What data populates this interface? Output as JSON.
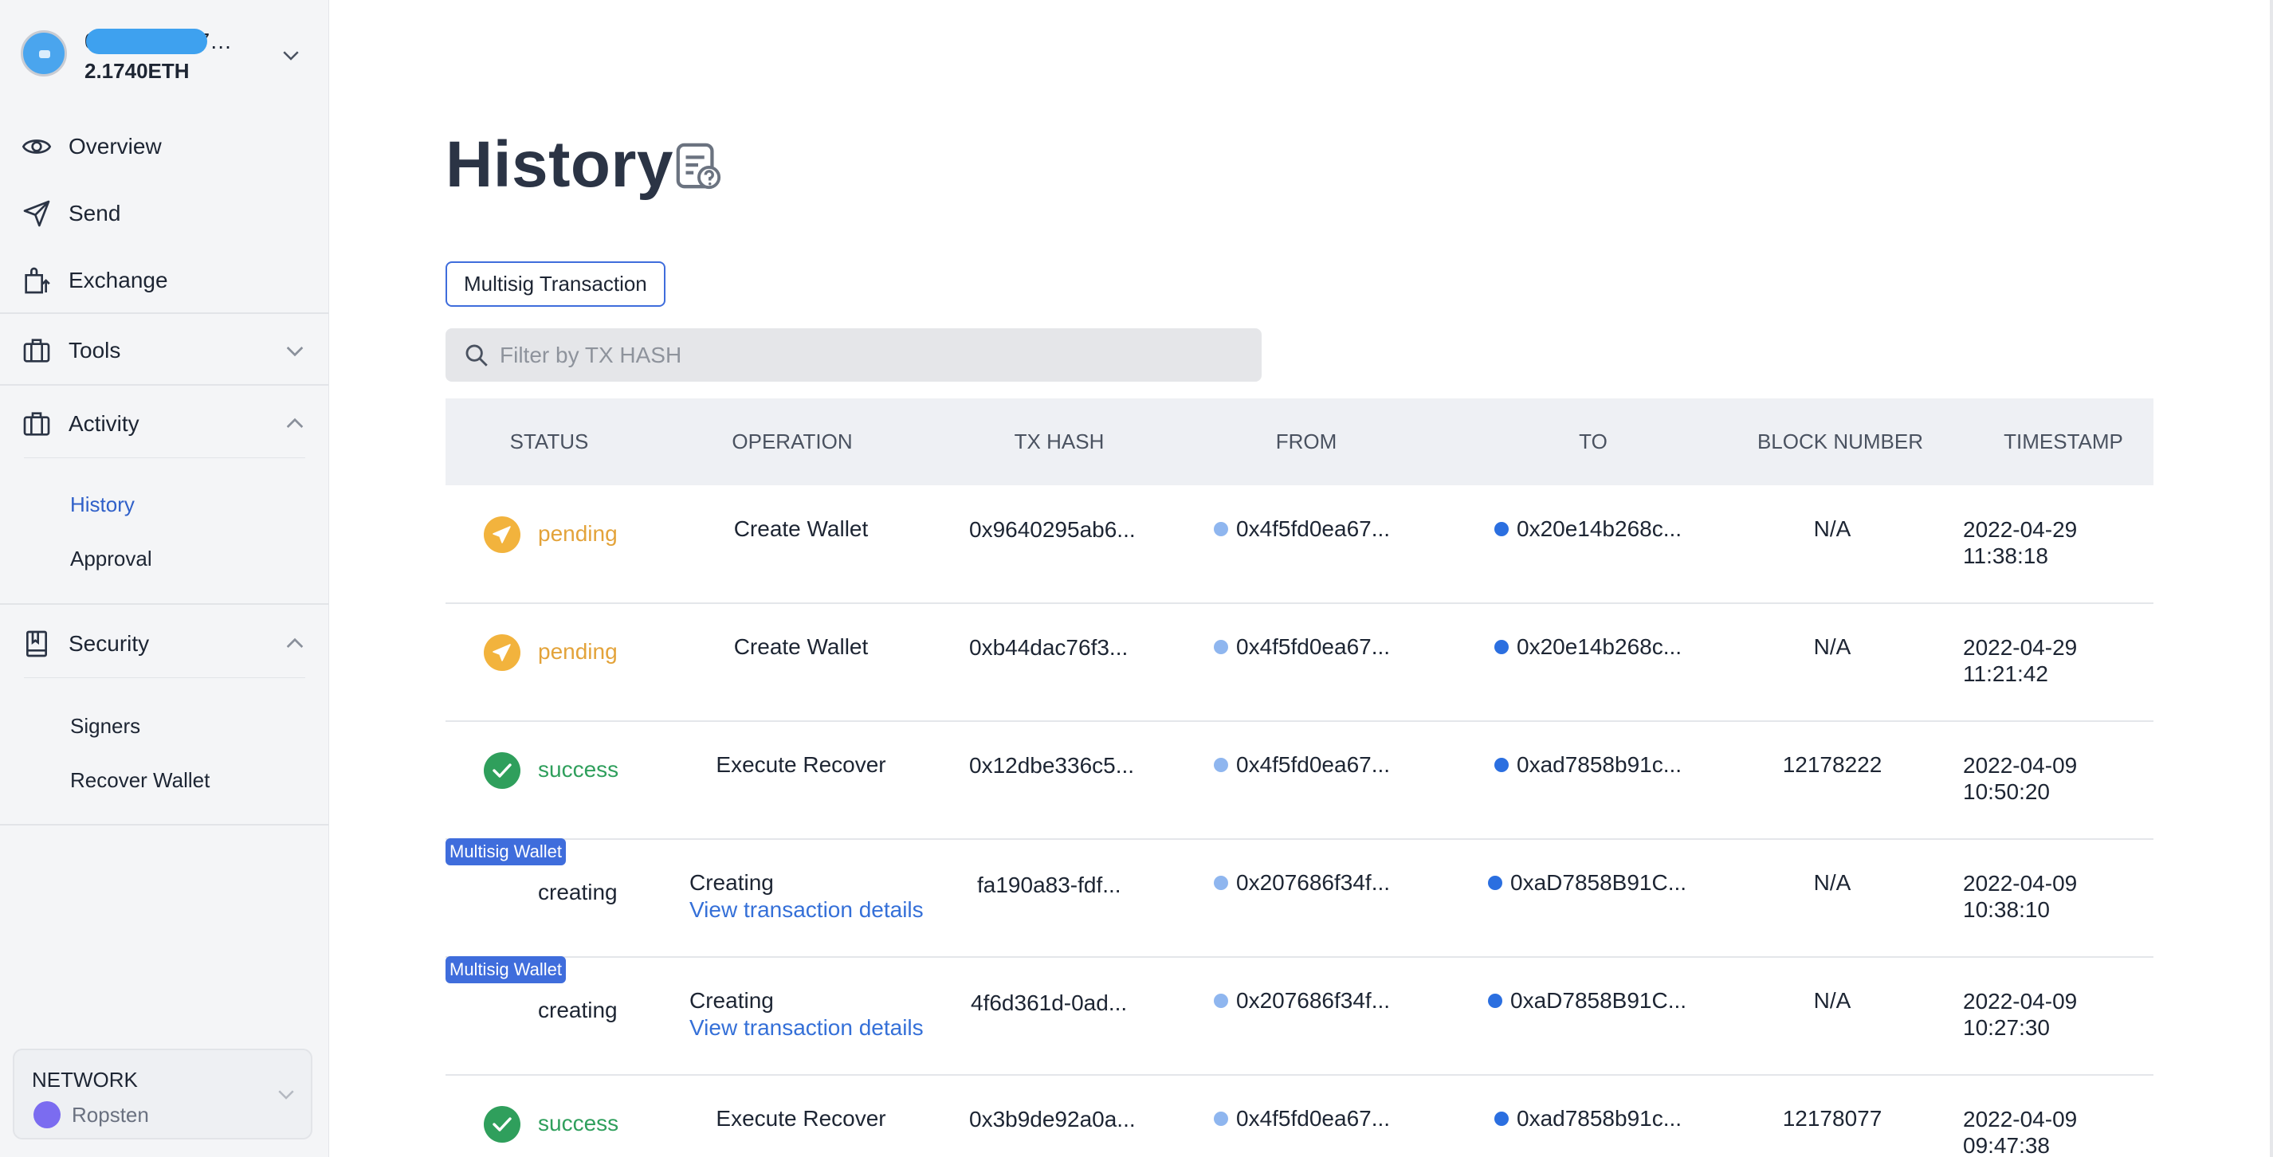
{
  "colors": {
    "accent": "#3f6ddc",
    "pending": "#e3a33a",
    "success": "#2f9f5c",
    "link": "#3570d8",
    "sidebar_bg": "#f4f5f7"
  },
  "account": {
    "address": "0x…………7…",
    "balance": "2.1740ETH"
  },
  "sidebar": {
    "items": [
      {
        "label": "Overview",
        "icon": "eye-icon"
      },
      {
        "label": "Send",
        "icon": "send-icon"
      },
      {
        "label": "Exchange",
        "icon": "exchange-icon"
      },
      {
        "label": "Tools",
        "icon": "toolbox-icon",
        "expanded": false
      },
      {
        "label": "Activity",
        "icon": "briefcase-icon",
        "expanded": true
      },
      {
        "label": "Security",
        "icon": "book-icon",
        "expanded": true
      }
    ],
    "activity_sub": [
      {
        "label": "History",
        "active": true
      },
      {
        "label": "Approval",
        "active": false
      }
    ],
    "security_sub": [
      {
        "label": "Signers"
      },
      {
        "label": "Recover Wallet"
      }
    ],
    "network": {
      "title": "NETWORK",
      "name": "Ropsten"
    }
  },
  "main": {
    "title": "History",
    "filter_chip": "Multisig Transaction",
    "search_placeholder": "Filter by TX HASH",
    "columns": [
      "STATUS",
      "OPERATION",
      "TX HASH",
      "FROM",
      "TO",
      "BLOCK NUMBER",
      "TIMESTAMP"
    ],
    "rows": [
      {
        "status": "pending",
        "operation": "Create Wallet",
        "tx_hash": "0x9640295ab6...",
        "from": "0x4f5fd0ea67...",
        "to": "0x20e14b268c...",
        "block": "N/A",
        "timestamp": "2022-04-29 11:38:18"
      },
      {
        "status": "pending",
        "operation": "Create Wallet",
        "tx_hash": "0xb44dac76f3...",
        "from": "0x4f5fd0ea67...",
        "to": "0x20e14b268c...",
        "block": "N/A",
        "timestamp": "2022-04-29 11:21:42"
      },
      {
        "status": "success",
        "operation": "Execute Recover",
        "tx_hash": "0x12dbe336c5...",
        "from": "0x4f5fd0ea67...",
        "to": "0xad7858b91c...",
        "block": "12178222",
        "timestamp": "2022-04-09 10:50:20"
      },
      {
        "badge": "Multisig Wallet",
        "status": "creating",
        "operation": "Creating",
        "link": "View transaction details",
        "tx_hash": "fa190a83-fdf...",
        "from": "0x207686f34f...",
        "to": "0xaD7858B91C...",
        "block": "N/A",
        "timestamp": "2022-04-09 10:38:10"
      },
      {
        "badge": "Multisig Wallet",
        "status": "creating",
        "operation": "Creating",
        "link": "View transaction details",
        "tx_hash": "4f6d361d-0ad...",
        "from": "0x207686f34f...",
        "to": "0xaD7858B91C...",
        "block": "N/A",
        "timestamp": "2022-04-09 10:27:30"
      },
      {
        "status": "success",
        "operation": "Execute Recover",
        "tx_hash": "0x3b9de92a0a...",
        "from": "0x4f5fd0ea67...",
        "to": "0xad7858b91c...",
        "block": "12178077",
        "timestamp": "2022-04-09 09:47:38"
      }
    ]
  }
}
